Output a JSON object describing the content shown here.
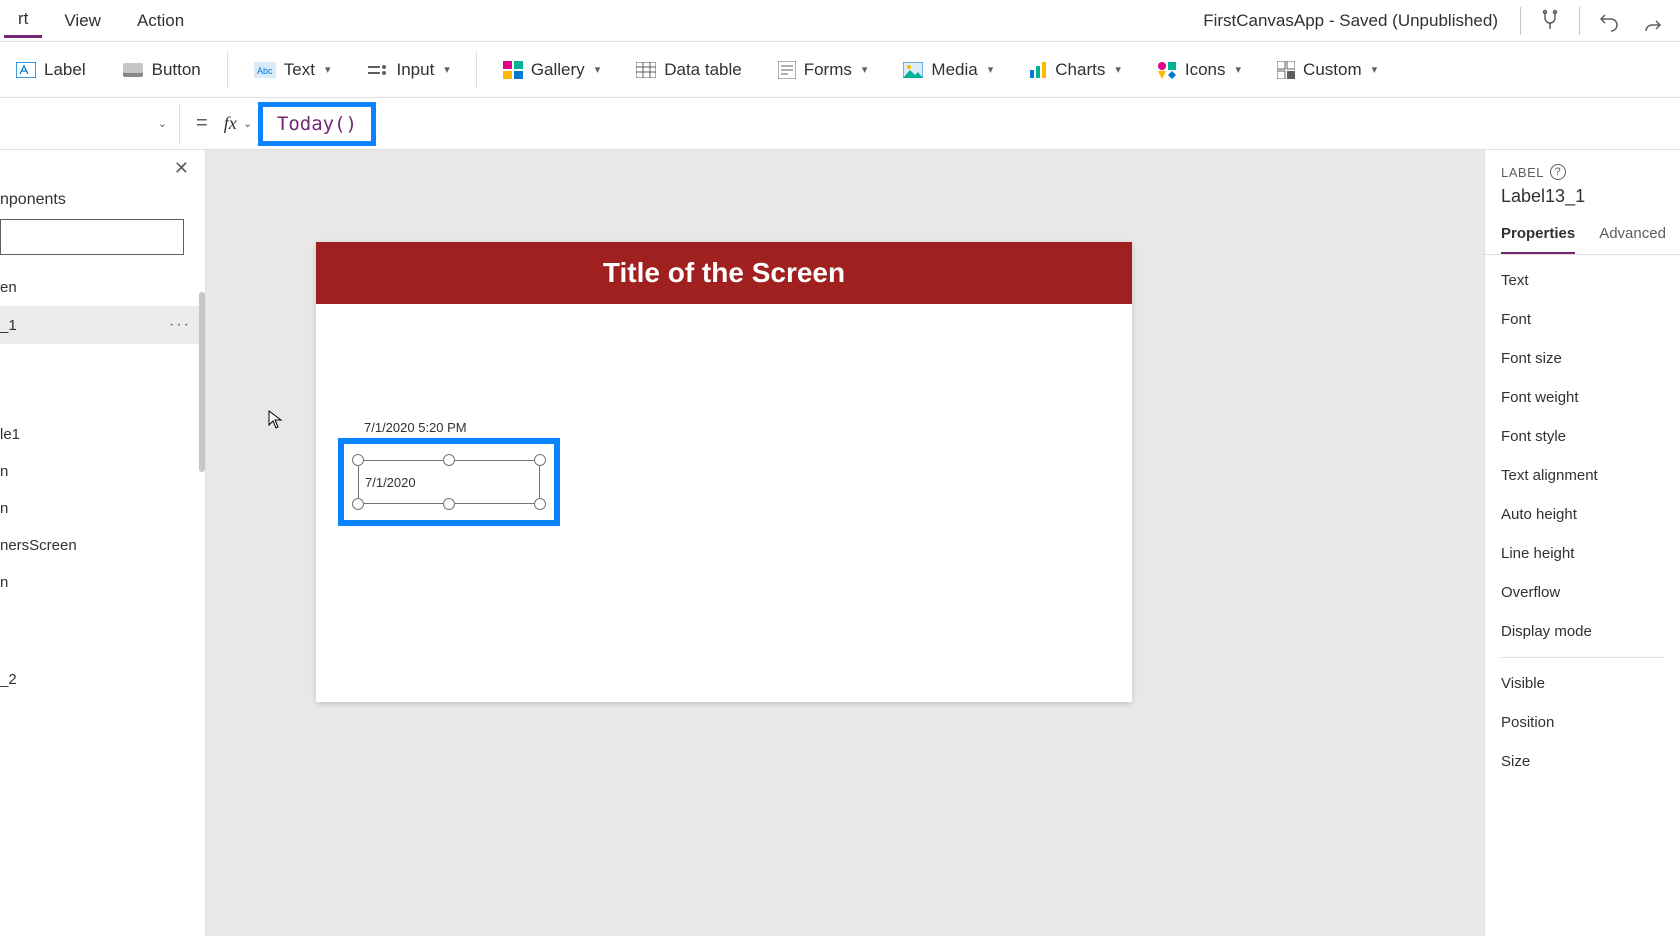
{
  "menubar": {
    "items": [
      "rt",
      "View",
      "Action"
    ],
    "app_status": "FirstCanvasApp - Saved (Unpublished)"
  },
  "ribbon": {
    "label": "Label",
    "button": "Button",
    "text": "Text",
    "input": "Input",
    "gallery": "Gallery",
    "datatable": "Data table",
    "forms": "Forms",
    "media": "Media",
    "charts": "Charts",
    "icons": "Icons",
    "custom": "Custom"
  },
  "formula": {
    "equals": "=",
    "fx": "fx",
    "value": "Today()"
  },
  "leftpane": {
    "tab": "nponents",
    "items": [
      "en",
      "_1",
      "le1",
      "n",
      "n",
      "nersScreen",
      "n",
      "_2"
    ]
  },
  "canvas": {
    "title": "Title of the Screen",
    "label_above": "7/1/2020 5:20 PM",
    "selected_label_text": "7/1/2020"
  },
  "rightpane": {
    "type": "LABEL",
    "name": "Label13_1",
    "tabs": {
      "properties": "Properties",
      "advanced": "Advanced"
    },
    "props1": [
      "Text",
      "Font",
      "Font size",
      "Font weight",
      "Font style",
      "Text alignment",
      "Auto height",
      "Line height",
      "Overflow",
      "Display mode"
    ],
    "props2": [
      "Visible",
      "Position",
      "Size"
    ]
  }
}
